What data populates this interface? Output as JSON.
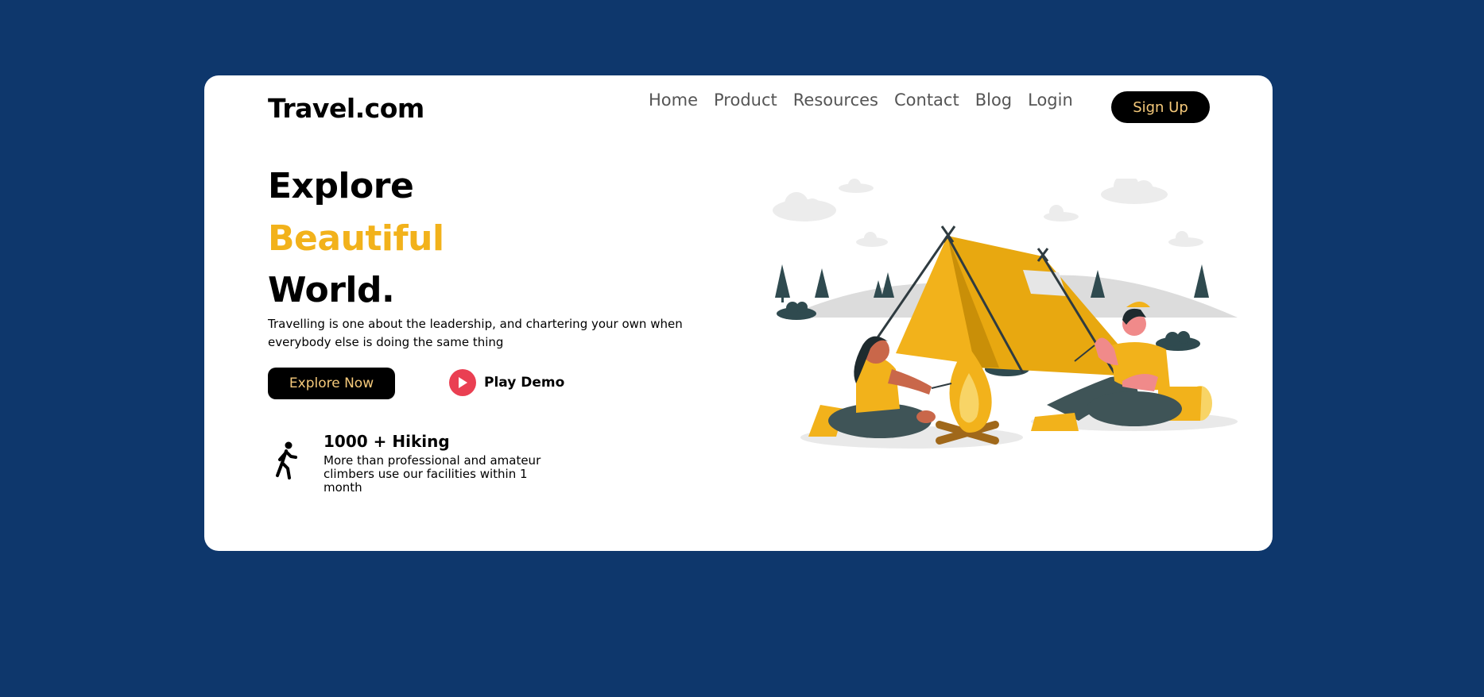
{
  "brand": {
    "logo": "Travel.com"
  },
  "nav": {
    "items": [
      "Home",
      "Product",
      "Resources",
      "Contact",
      "Blog",
      "Login"
    ],
    "signup_label": "Sign Up"
  },
  "hero": {
    "line1": "Explore",
    "line2": "Beautiful",
    "line3": "World.",
    "description": "Travelling is one about the leadership, and chartering your own when everybody else is doing the same thing",
    "explore_label": "Explore Now",
    "play_label": "Play Demo"
  },
  "stat": {
    "title": "1000 + Hiking",
    "description": "More than professional and amateur climbers use our facilities within 1 month"
  },
  "colors": {
    "background": "#0e376c",
    "accent": "#f2b21b",
    "button_text": "#f5c97a",
    "play": "#ea3f52"
  },
  "icons": {
    "play": "play-icon",
    "hiking": "hiking-person-icon",
    "illustration": "camping-illustration"
  }
}
